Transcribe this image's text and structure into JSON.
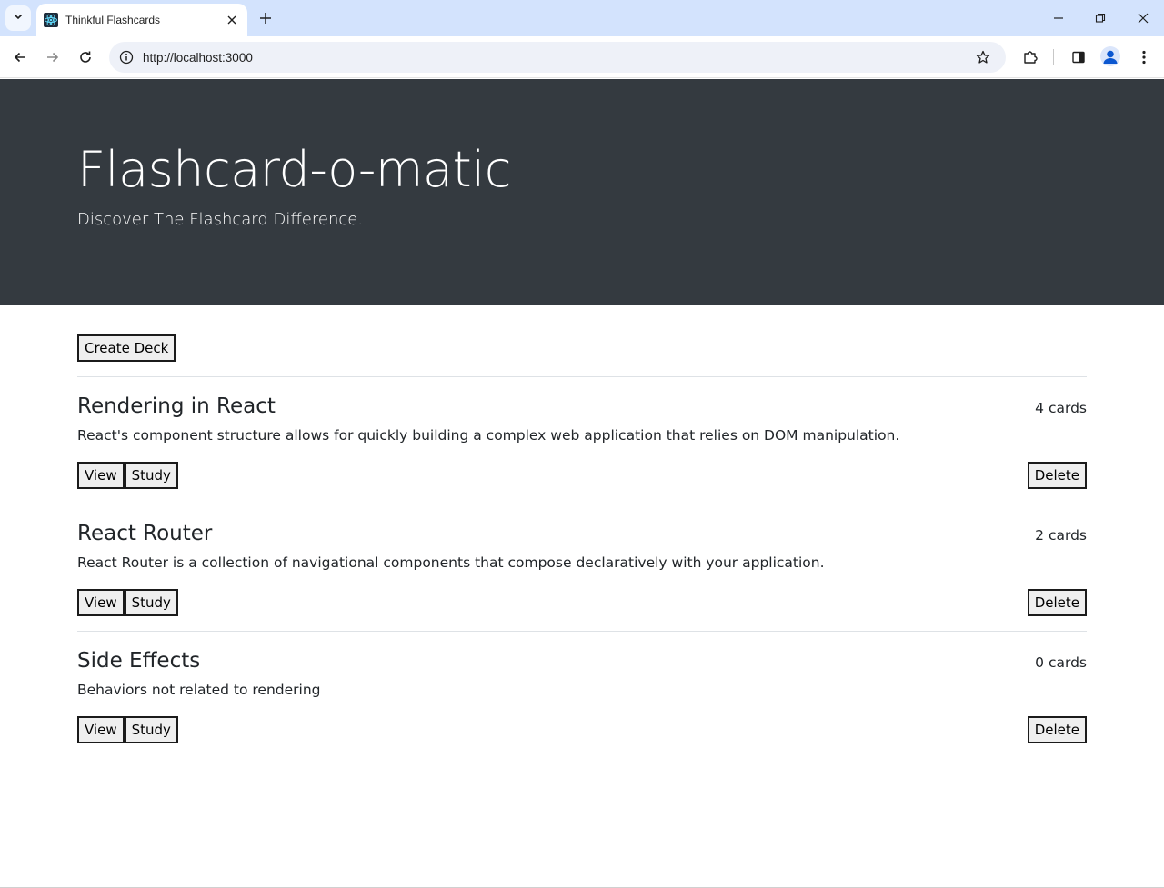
{
  "browser": {
    "tab": {
      "title": "Thinkful Flashcards",
      "favicon": "react-atom-icon"
    },
    "url": "http://localhost:3000",
    "accent": "#d3e3fd"
  },
  "header": {
    "title": "Flashcard-o-matic",
    "subtitle": "Discover The Flashcard Difference.",
    "background": "#343a40"
  },
  "actions": {
    "create_deck_label": "Create Deck"
  },
  "decks": [
    {
      "name": "Rendering in React",
      "count_label": "4 cards",
      "description": "React's component structure allows for quickly building a complex web application that relies on DOM manipulation.",
      "view_label": "View",
      "study_label": "Study",
      "delete_label": "Delete"
    },
    {
      "name": "React Router",
      "count_label": "2 cards",
      "description": "React Router is a collection of navigational components that compose declaratively with your application.",
      "view_label": "View",
      "study_label": "Study",
      "delete_label": "Delete"
    },
    {
      "name": "Side Effects",
      "count_label": "0 cards",
      "description": "Behaviors not related to rendering",
      "view_label": "View",
      "study_label": "Study",
      "delete_label": "Delete"
    }
  ]
}
